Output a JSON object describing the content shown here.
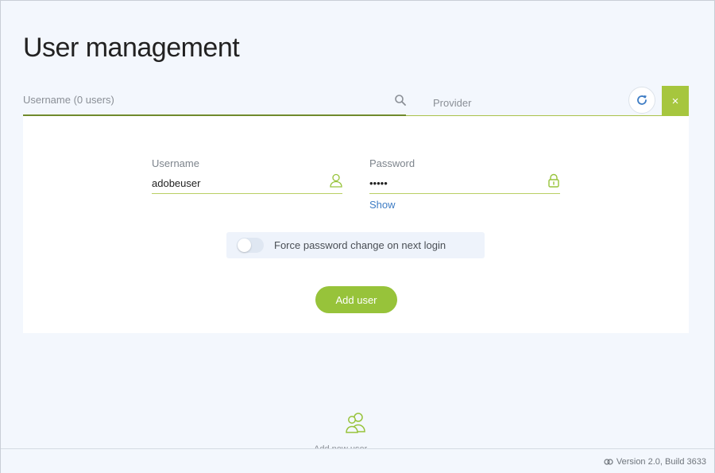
{
  "page": {
    "title": "User management"
  },
  "search": {
    "placeholder": "Username (0 users)"
  },
  "provider": {
    "label": "Provider"
  },
  "close": {
    "glyph": "×"
  },
  "form": {
    "username": {
      "label": "Username",
      "value": "adobeuser"
    },
    "password": {
      "label": "Password",
      "value": "•••••"
    },
    "show_label": "Show",
    "force_change_label": "Force password change on next login",
    "add_user_label": "Add user"
  },
  "empty_state": {
    "label": "Add new user"
  },
  "footer": {
    "version": "Version 2.0, Build 3633"
  },
  "colors": {
    "accent": "#97c33a",
    "link": "#3d7cc4",
    "background": "#f3f7fd"
  }
}
